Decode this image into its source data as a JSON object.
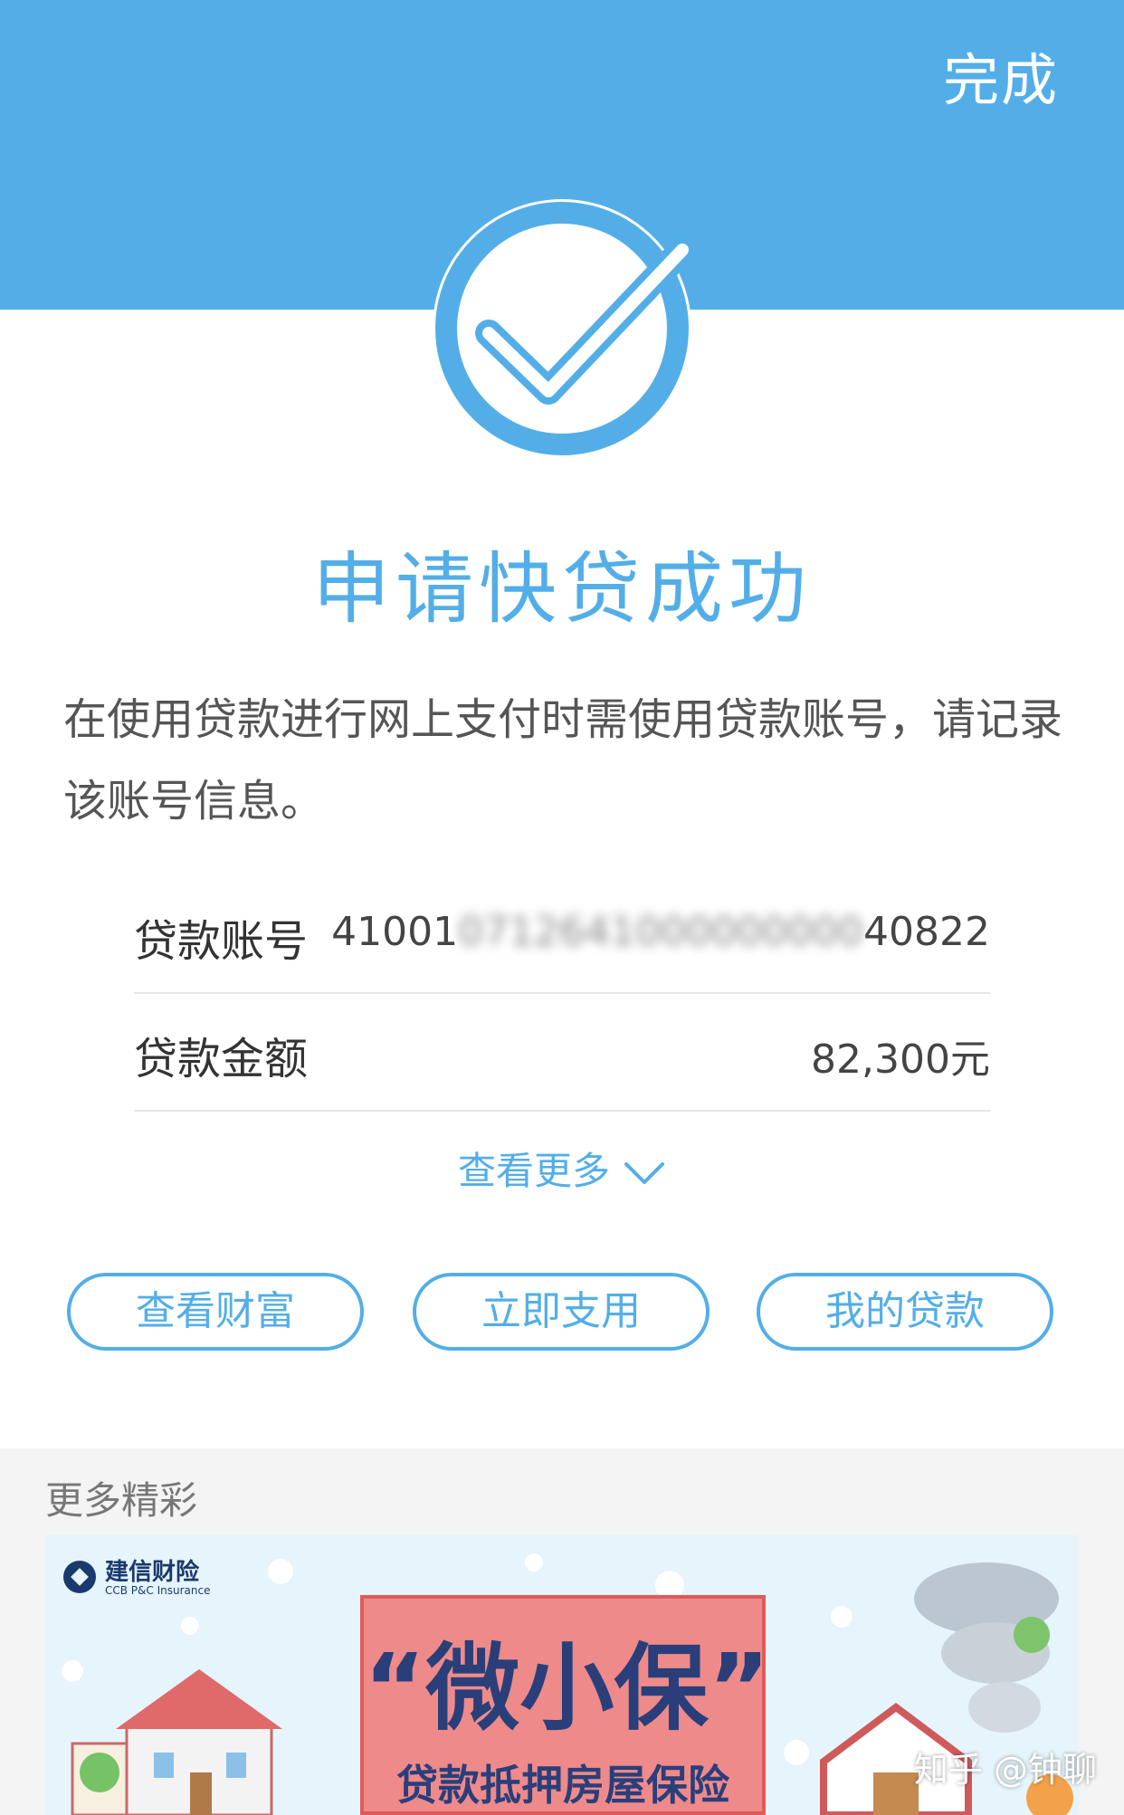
{
  "header": {
    "done_label": "完成"
  },
  "result": {
    "title": "申请快贷成功",
    "notice": "在使用贷款进行网上支付时需使用贷款账号，请记录该账号信息。"
  },
  "loan_info": {
    "account_label": "贷款账号",
    "account_prefix": "41001",
    "account_masked": "0712641000000000",
    "account_suffix": "40822",
    "amount_label": "贷款金额",
    "amount_value": "82,300元"
  },
  "more_link": "查看更多",
  "actions": [
    {
      "label": "查看财富"
    },
    {
      "label": "立即支用"
    },
    {
      "label": "我的贷款"
    }
  ],
  "more_section": {
    "title": "更多精彩",
    "banner": {
      "brand_name": "建信财险",
      "brand_en": "CCB P&C Insurance",
      "promo_title": "“微小保”",
      "promo_subtitle": "贷款抵押房屋保险"
    }
  },
  "watermark": "知乎 @钟聊",
  "colors": {
    "accent": "#53aee8",
    "promo_red": "#ef8a8a",
    "navy": "#2a3f7a"
  },
  "icons": {
    "success": "check-circle-icon",
    "expand": "chevron-down-icon"
  }
}
